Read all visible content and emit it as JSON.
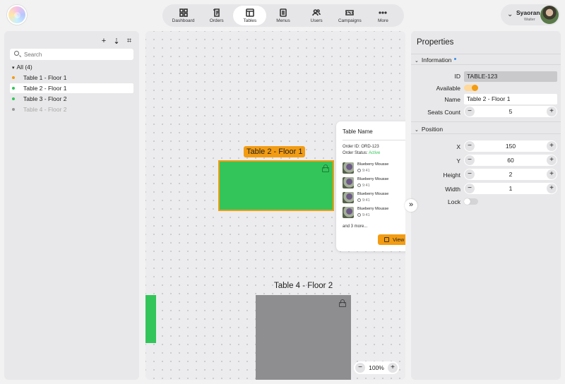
{
  "nav": [
    {
      "label": "Dashboard",
      "icon": "dashboard-icon",
      "active": false
    },
    {
      "label": "Orders",
      "icon": "orders-icon",
      "active": false
    },
    {
      "label": "Tables",
      "icon": "tables-icon",
      "active": true
    },
    {
      "label": "Menus",
      "icon": "menus-icon",
      "active": false
    },
    {
      "label": "Users",
      "icon": "users-icon",
      "active": false
    },
    {
      "label": "Campaigns",
      "icon": "campaigns-icon",
      "active": false
    },
    {
      "label": "More",
      "icon": "more-icon",
      "active": false
    }
  ],
  "user": {
    "name": "Syaoran",
    "role": "Waiter"
  },
  "left": {
    "search_placeholder": "Search",
    "all_label": "All (4)",
    "items": [
      {
        "label": "Table 1 - Floor 1",
        "dot": "#f39c12",
        "selected": false,
        "disabled": false
      },
      {
        "label": "Table 2 - Floor 1",
        "dot": "#33c55a",
        "selected": true,
        "disabled": false
      },
      {
        "label": "Table 3 - Floor 2",
        "dot": "#33c55a",
        "selected": false,
        "disabled": false
      },
      {
        "label": "Table 4 - Floor 2",
        "dot": "#999999",
        "selected": false,
        "disabled": true
      }
    ]
  },
  "canvas": {
    "table2_label": "Table 2 - Floor 1",
    "table4_label": "Table 4 - Floor 2",
    "zoom": "100%",
    "popup": {
      "title": "Table Name",
      "order_id": "Order ID: ORD-123",
      "status_prefix": "Order Status: ",
      "status": "Active",
      "items": [
        {
          "name": "Blueberry Mousse",
          "time": "9:41"
        },
        {
          "name": "Blueberry Mousse",
          "time": "9:41"
        },
        {
          "name": "Blueberry Mousse",
          "time": "9:41"
        },
        {
          "name": "Blueberry Mousse",
          "time": "9:41"
        }
      ],
      "more": "and 3 more...",
      "view_label": "View"
    },
    "expand_label": "»"
  },
  "properties": {
    "title": "Properties",
    "information_label": "Information",
    "id_label": "ID",
    "id_value": "TABLE-123",
    "available_label": "Available",
    "available": true,
    "name_label": "Name",
    "name_value": "Table 2 - Floor 1",
    "seats_label": "Seats Count",
    "seats_value": "5",
    "position_label": "Position",
    "x_label": "X",
    "x_value": "150",
    "y_label": "Y",
    "y_value": "60",
    "height_label": "Height",
    "height_value": "2",
    "width_label": "Width",
    "width_value": "1",
    "lock_label": "Lock",
    "lock": false
  },
  "colors": {
    "accent": "#f39c12",
    "available": "#33c55a",
    "unavailable": "#8e8e90"
  }
}
